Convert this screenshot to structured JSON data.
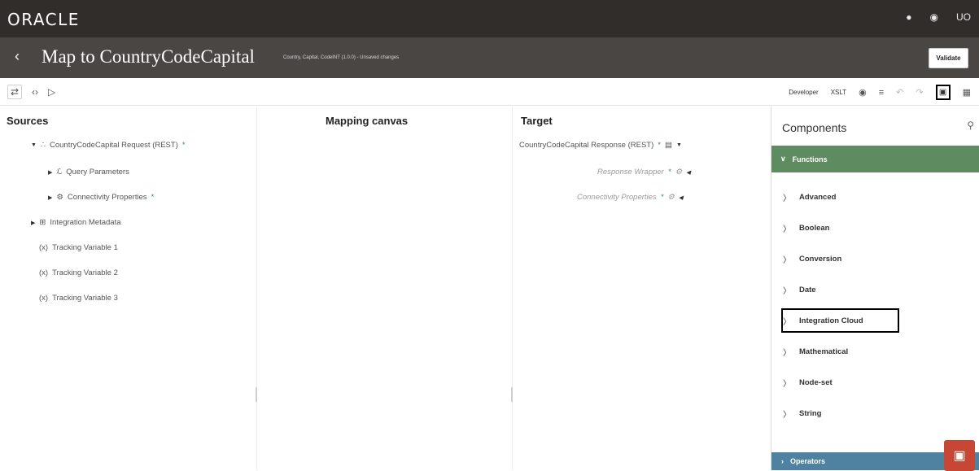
{
  "header": {
    "logo": "ORACLE",
    "icons": [
      "bell-icon",
      "help-icon"
    ],
    "user_initials": "UO"
  },
  "titlebar": {
    "back_icon": "chevron-left-icon",
    "title": "Map to CountryCodeCapital",
    "subtitle": "Country, Capital, CodeINT (1.0.0) - Unsaved changes",
    "validate_label": "Validate"
  },
  "toolbar": {
    "developer_label": "Developer",
    "xslt_label": "XSLT",
    "left_icons": [
      "swap-icon",
      "code-icon",
      "play-icon"
    ],
    "right_icons": [
      "eye-icon",
      "filter-icon",
      "undo-icon",
      "redo-icon",
      "panel-icon",
      "expand-icon"
    ]
  },
  "sources": {
    "heading": "Sources",
    "items": [
      {
        "label": "CountryCodeCapital Request (REST)",
        "required": "*"
      },
      {
        "label": "Query Parameters"
      },
      {
        "label": "Connectivity Properties",
        "required": "*"
      },
      {
        "label": "Integration Metadata"
      },
      {
        "label": "Tracking Variable 1"
      },
      {
        "label": "Tracking Variable 2"
      },
      {
        "label": "Tracking Variable 3"
      }
    ]
  },
  "mapping": {
    "heading": "Mapping canvas"
  },
  "target": {
    "heading": "Target",
    "items": [
      {
        "label": "CountryCodeCapital Response (REST)",
        "required": "*"
      },
      {
        "label": "Response Wrapper",
        "required": "*"
      },
      {
        "label": "Connectivity Properties",
        "required": "*"
      }
    ]
  },
  "components": {
    "title": "Components",
    "functions_label": "Functions",
    "functions": [
      "Advanced",
      "Boolean",
      "Conversion",
      "Date",
      "Integration Cloud",
      "Mathematical",
      "Node-set",
      "String"
    ],
    "operators_label": "Operators"
  },
  "colors": {
    "topbar": "#312d2a",
    "titlebar": "#4a4643",
    "functions": "#5e8b5f",
    "operators": "#4e82a0",
    "chat": "#c74634"
  }
}
